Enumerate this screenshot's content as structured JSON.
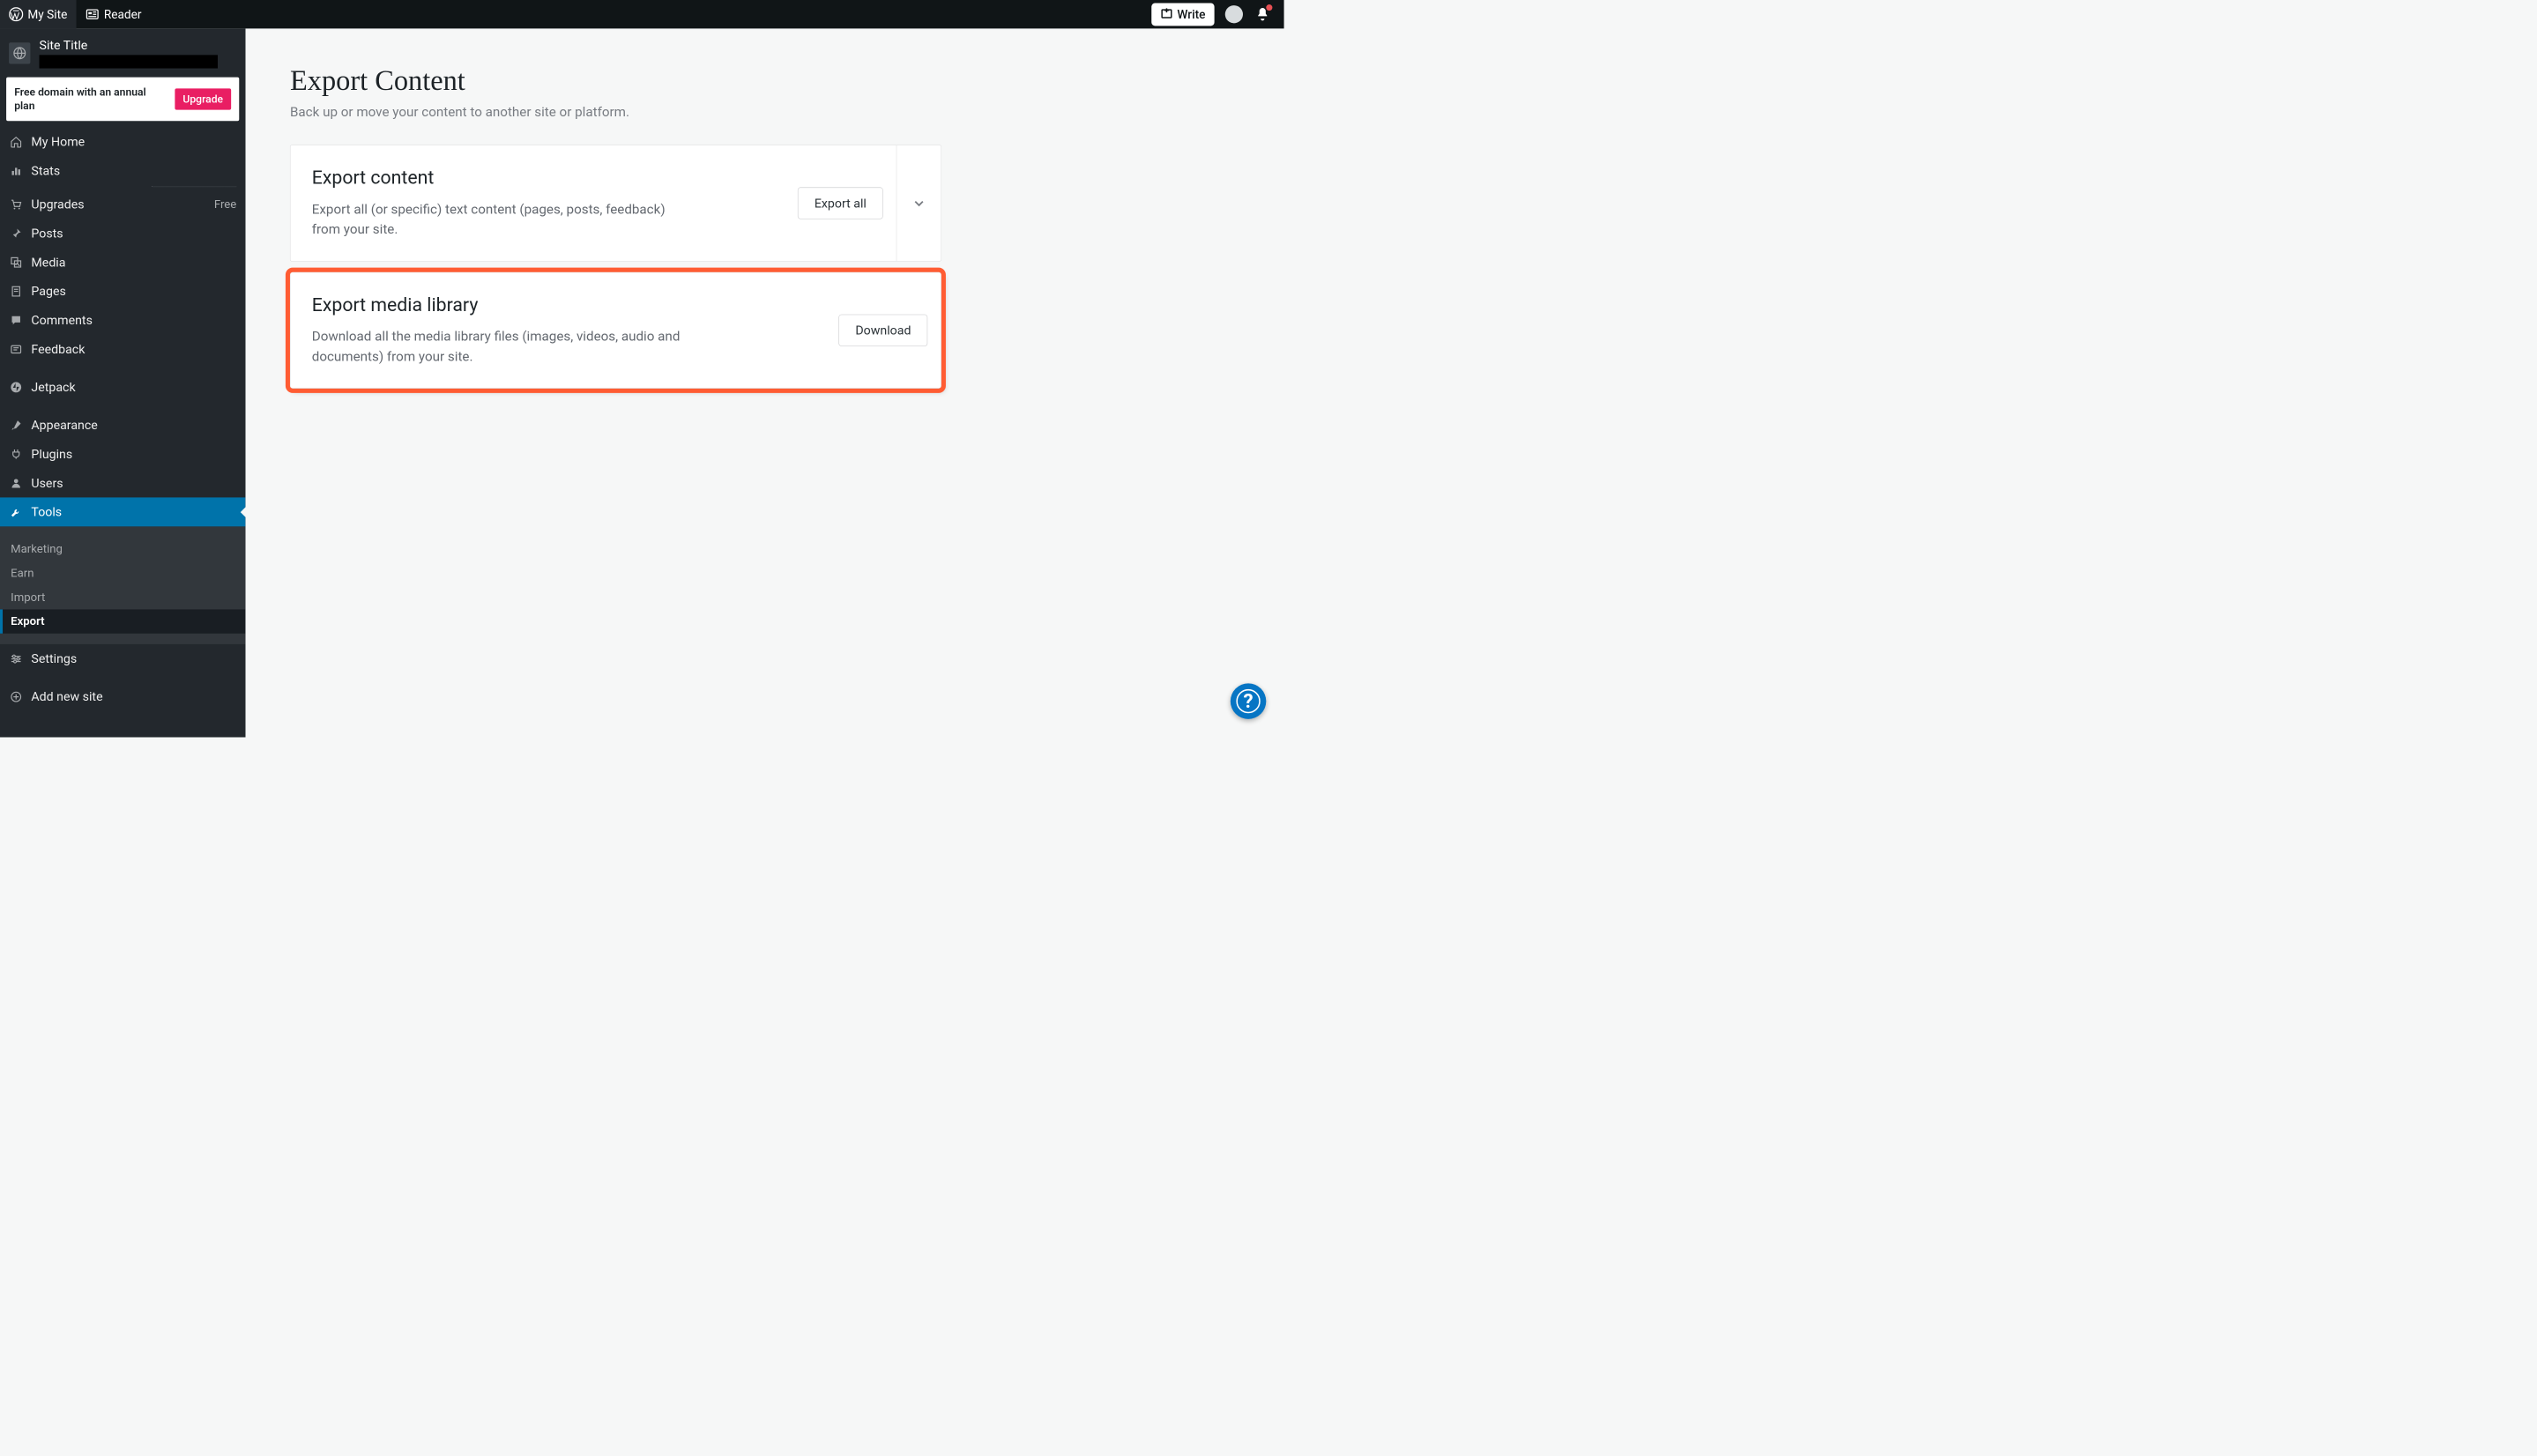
{
  "topbar": {
    "mysite": "My Site",
    "reader": "Reader",
    "write": "Write"
  },
  "site": {
    "title": "Site Title"
  },
  "upgrade_card": {
    "text": "Free domain with an annual plan",
    "button": "Upgrade"
  },
  "sidebar": {
    "items": [
      {
        "label": "My Home",
        "icon": "home"
      },
      {
        "label": "Stats",
        "icon": "stats"
      },
      {
        "label": "Upgrades",
        "icon": "cart",
        "badge": "Free"
      },
      {
        "label": "Posts",
        "icon": "pin"
      },
      {
        "label": "Media",
        "icon": "media"
      },
      {
        "label": "Pages",
        "icon": "page"
      },
      {
        "label": "Comments",
        "icon": "comment"
      },
      {
        "label": "Feedback",
        "icon": "feedback"
      },
      {
        "label": "Jetpack",
        "icon": "jetpack",
        "sep_before": true
      },
      {
        "label": "Appearance",
        "icon": "brush",
        "sep_before": true
      },
      {
        "label": "Plugins",
        "icon": "plug"
      },
      {
        "label": "Users",
        "icon": "user"
      },
      {
        "label": "Tools",
        "icon": "tools",
        "selected": true,
        "sub": [
          "Marketing",
          "Earn",
          "Import",
          "Export"
        ],
        "current_sub": "Export"
      },
      {
        "label": "Settings",
        "icon": "settings"
      },
      {
        "label": "Add new site",
        "icon": "plus",
        "sep_before": true
      }
    ]
  },
  "page": {
    "title": "Export Content",
    "subtitle": "Back up or move your content to another site or platform."
  },
  "cards": {
    "export_content": {
      "title": "Export content",
      "desc": "Export all (or specific) text content (pages, posts, feedback) from your site.",
      "action": "Export all"
    },
    "export_media": {
      "title": "Export media library",
      "desc": "Download all the media library files (images, videos, audio and documents) from your site.",
      "action": "Download"
    }
  },
  "help": "?"
}
